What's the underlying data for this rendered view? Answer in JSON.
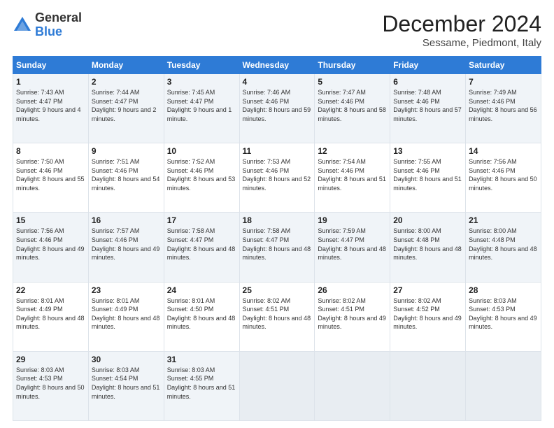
{
  "logo": {
    "general": "General",
    "blue": "Blue"
  },
  "title": "December 2024",
  "location": "Sessame, Piedmont, Italy",
  "days_header": [
    "Sunday",
    "Monday",
    "Tuesday",
    "Wednesday",
    "Thursday",
    "Friday",
    "Saturday"
  ],
  "weeks": [
    [
      {
        "num": "1",
        "rise": "7:43 AM",
        "set": "4:47 PM",
        "daylight": "9 hours and 4 minutes."
      },
      {
        "num": "2",
        "rise": "7:44 AM",
        "set": "4:47 PM",
        "daylight": "9 hours and 2 minutes."
      },
      {
        "num": "3",
        "rise": "7:45 AM",
        "set": "4:47 PM",
        "daylight": "9 hours and 1 minute."
      },
      {
        "num": "4",
        "rise": "7:46 AM",
        "set": "4:46 PM",
        "daylight": "8 hours and 59 minutes."
      },
      {
        "num": "5",
        "rise": "7:47 AM",
        "set": "4:46 PM",
        "daylight": "8 hours and 58 minutes."
      },
      {
        "num": "6",
        "rise": "7:48 AM",
        "set": "4:46 PM",
        "daylight": "8 hours and 57 minutes."
      },
      {
        "num": "7",
        "rise": "7:49 AM",
        "set": "4:46 PM",
        "daylight": "8 hours and 56 minutes."
      }
    ],
    [
      {
        "num": "8",
        "rise": "7:50 AM",
        "set": "4:46 PM",
        "daylight": "8 hours and 55 minutes."
      },
      {
        "num": "9",
        "rise": "7:51 AM",
        "set": "4:46 PM",
        "daylight": "8 hours and 54 minutes."
      },
      {
        "num": "10",
        "rise": "7:52 AM",
        "set": "4:46 PM",
        "daylight": "8 hours and 53 minutes."
      },
      {
        "num": "11",
        "rise": "7:53 AM",
        "set": "4:46 PM",
        "daylight": "8 hours and 52 minutes."
      },
      {
        "num": "12",
        "rise": "7:54 AM",
        "set": "4:46 PM",
        "daylight": "8 hours and 51 minutes."
      },
      {
        "num": "13",
        "rise": "7:55 AM",
        "set": "4:46 PM",
        "daylight": "8 hours and 51 minutes."
      },
      {
        "num": "14",
        "rise": "7:56 AM",
        "set": "4:46 PM",
        "daylight": "8 hours and 50 minutes."
      }
    ],
    [
      {
        "num": "15",
        "rise": "7:56 AM",
        "set": "4:46 PM",
        "daylight": "8 hours and 49 minutes."
      },
      {
        "num": "16",
        "rise": "7:57 AM",
        "set": "4:46 PM",
        "daylight": "8 hours and 49 minutes."
      },
      {
        "num": "17",
        "rise": "7:58 AM",
        "set": "4:47 PM",
        "daylight": "8 hours and 48 minutes."
      },
      {
        "num": "18",
        "rise": "7:58 AM",
        "set": "4:47 PM",
        "daylight": "8 hours and 48 minutes."
      },
      {
        "num": "19",
        "rise": "7:59 AM",
        "set": "4:47 PM",
        "daylight": "8 hours and 48 minutes."
      },
      {
        "num": "20",
        "rise": "8:00 AM",
        "set": "4:48 PM",
        "daylight": "8 hours and 48 minutes."
      },
      {
        "num": "21",
        "rise": "8:00 AM",
        "set": "4:48 PM",
        "daylight": "8 hours and 48 minutes."
      }
    ],
    [
      {
        "num": "22",
        "rise": "8:01 AM",
        "set": "4:49 PM",
        "daylight": "8 hours and 48 minutes."
      },
      {
        "num": "23",
        "rise": "8:01 AM",
        "set": "4:49 PM",
        "daylight": "8 hours and 48 minutes."
      },
      {
        "num": "24",
        "rise": "8:01 AM",
        "set": "4:50 PM",
        "daylight": "8 hours and 48 minutes."
      },
      {
        "num": "25",
        "rise": "8:02 AM",
        "set": "4:51 PM",
        "daylight": "8 hours and 48 minutes."
      },
      {
        "num": "26",
        "rise": "8:02 AM",
        "set": "4:51 PM",
        "daylight": "8 hours and 49 minutes."
      },
      {
        "num": "27",
        "rise": "8:02 AM",
        "set": "4:52 PM",
        "daylight": "8 hours and 49 minutes."
      },
      {
        "num": "28",
        "rise": "8:03 AM",
        "set": "4:53 PM",
        "daylight": "8 hours and 49 minutes."
      }
    ],
    [
      {
        "num": "29",
        "rise": "8:03 AM",
        "set": "4:53 PM",
        "daylight": "8 hours and 50 minutes."
      },
      {
        "num": "30",
        "rise": "8:03 AM",
        "set": "4:54 PM",
        "daylight": "8 hours and 51 minutes."
      },
      {
        "num": "31",
        "rise": "8:03 AM",
        "set": "4:55 PM",
        "daylight": "8 hours and 51 minutes."
      },
      null,
      null,
      null,
      null
    ]
  ]
}
